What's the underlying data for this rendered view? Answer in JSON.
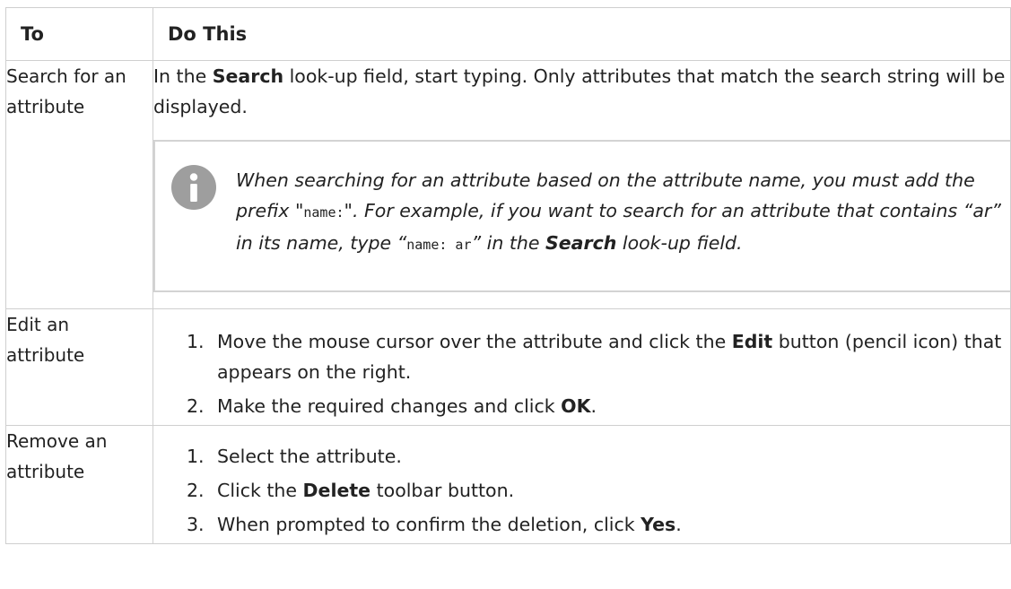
{
  "headers": {
    "col1": "To",
    "col2": "Do This"
  },
  "rows": [
    {
      "task": "Search for an attribute",
      "text": {
        "pre": "In the ",
        "bold": "Search",
        "post": " look-up field, start typing. Only attributes that match the search string will be displayed."
      },
      "note": {
        "icon": "info-icon",
        "p1": "When searching for an attribute based on the attribute name, you must add the prefix \"",
        "code1": "name:",
        "p2": "\". For example, if you want to search for an attribute that contains “ar” in its name, type “",
        "code2": "name: ar",
        "p3": "” in the ",
        "bold": "Search",
        "p4": " look-up field."
      }
    },
    {
      "task": "Edit an attribute",
      "steps": [
        {
          "num": "1.",
          "pre": "Move the mouse cursor over the attribute and click the ",
          "bold": "Edit",
          "post": " button (pencil icon) that appears on the right."
        },
        {
          "num": "2.",
          "pre": "Make the required changes and click ",
          "bold": "OK",
          "post": "."
        }
      ]
    },
    {
      "task": "Remove an attribute",
      "steps": [
        {
          "num": "1.",
          "pre": "Select the attribute.",
          "bold": "",
          "post": ""
        },
        {
          "num": "2.",
          "pre": "Click the ",
          "bold": "Delete",
          "post": " toolbar button."
        },
        {
          "num": "3.",
          "pre": "When prompted to confirm the deletion, click ",
          "bold": "Yes",
          "post": "."
        }
      ]
    }
  ]
}
